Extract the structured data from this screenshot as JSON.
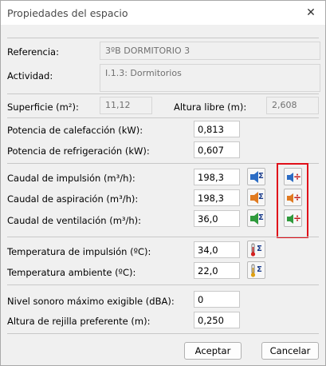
{
  "window": {
    "title": "Propiedades del espacio",
    "close_glyph": "✕"
  },
  "ident": {
    "referencia_label": "Referencia:",
    "referencia_value": "3ºB DORMITORIO 3",
    "actividad_label": "Actividad:",
    "actividad_value": "I.1.3: Dormitorios"
  },
  "superficie": {
    "label": "Superficie (m²):",
    "value": "11,12"
  },
  "altura_libre": {
    "label": "Altura libre (m):",
    "value": "2,608"
  },
  "potencias": [
    {
      "label": "Potencia de calefacción (kW):",
      "value": "0,813"
    },
    {
      "label": "Potencia de refrigeración (kW):",
      "value": "0,607"
    }
  ],
  "caudales": [
    {
      "label": "Caudal de impulsión (m³/h):",
      "value": "198,3",
      "color": "#2b6cc4"
    },
    {
      "label": "Caudal de aspiración (m³/h):",
      "value": "198,3",
      "color": "#e07a20"
    },
    {
      "label": "Caudal de ventilación (m³/h):",
      "value": "36,0",
      "color": "#2f9a3c"
    }
  ],
  "temperaturas": [
    {
      "label": "Temperatura de impulsión (ºC):",
      "value": "34,0",
      "color": "#d42020"
    },
    {
      "label": "Temperatura ambiente (ºC):",
      "value": "22,0",
      "color": "#e0a010"
    }
  ],
  "acustica": [
    {
      "label": "Nivel sonoro máximo exigible (dBA):",
      "value": "0"
    },
    {
      "label": "Altura de rejilla preferente (m):",
      "value": "0,250"
    }
  ],
  "icons": {
    "sum": "Σ",
    "divide": "÷",
    "sum_button_icon": "fan-sum-icon",
    "temp_button_icon": "thermometer-sum-icon",
    "divide_button_icon": "fan-divide-icon"
  },
  "accent": {
    "highlight_border": "#e0101a"
  },
  "buttons": {
    "accept": "Aceptar",
    "cancel": "Cancelar"
  }
}
